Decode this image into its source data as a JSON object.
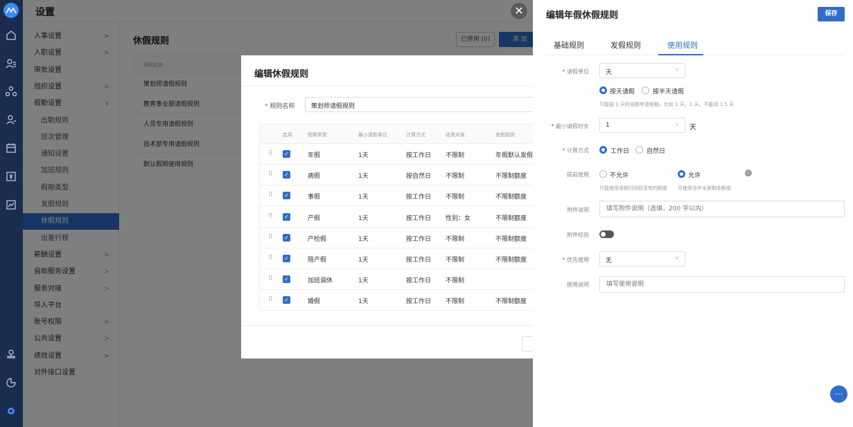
{
  "app": {
    "title": "设置"
  },
  "rail_icons": [
    "logo-icon",
    "home-icon",
    "user-list-icon",
    "org-icon",
    "person-icon",
    "calendar-icon",
    "wallet-icon",
    "chart-icon",
    "stamp-icon",
    "pie-icon",
    "settings-icon"
  ],
  "sidebar": {
    "items": [
      {
        "label": "人事设置",
        "chev": ">"
      },
      {
        "label": "入职设置",
        "chev": ">"
      },
      {
        "label": "审批设置",
        "chev": ""
      },
      {
        "label": "组织设置",
        "chev": ">"
      },
      {
        "label": "假勤设置",
        "chev": "∨"
      },
      {
        "label": "出勤规则",
        "chev": ""
      },
      {
        "label": "班次管理",
        "chev": ""
      },
      {
        "label": "通知设置",
        "chev": ""
      },
      {
        "label": "加班规则",
        "chev": ""
      },
      {
        "label": "假期类型",
        "chev": ""
      },
      {
        "label": "发假规则",
        "chev": ""
      },
      {
        "label": "休假规则",
        "chev": ""
      },
      {
        "label": "出差行程",
        "chev": ""
      },
      {
        "label": "薪酬设置",
        "chev": ">"
      },
      {
        "label": "自助服务设置",
        "chev": ">"
      },
      {
        "label": "服务对接",
        "chev": ">"
      },
      {
        "label": "导入平台",
        "chev": ""
      },
      {
        "label": "账号权限",
        "chev": ">"
      },
      {
        "label": "公共设置",
        "chev": ">"
      },
      {
        "label": "绩效设置",
        "chev": ">"
      },
      {
        "label": "对外接口设置",
        "chev": ""
      }
    ]
  },
  "page": {
    "title": "休假规则",
    "disabled_btn": "已停用 (0)",
    "add_btn": "添 加",
    "list_header": "规则名称",
    "list": [
      "策划师请假规则",
      "教育事业部请假规则",
      "人员专用请假规则",
      "技术部专用请假规则",
      "默认假期使用规则"
    ]
  },
  "modal": {
    "title": "编辑休假规则",
    "name_label": "规则名称",
    "name_value": "策划师请假规则",
    "headers": [
      "启用",
      "假期类型",
      "最小请假单位",
      "计算方式",
      "适用对象",
      "发假规则"
    ],
    "rows": [
      {
        "type": "年假",
        "unit": "1天",
        "calc": "按工作日",
        "target": "不限制",
        "rule": "年假默认发假规"
      },
      {
        "type": "病假",
        "unit": "1天",
        "calc": "按自然日",
        "target": "不限制",
        "rule": "不限制额度"
      },
      {
        "type": "事假",
        "unit": "1天",
        "calc": "按工作日",
        "target": "不限制",
        "rule": "不限制额度"
      },
      {
        "type": "产假",
        "unit": "1天",
        "calc": "按工作日",
        "target": "性别：女",
        "rule": "不限制额度"
      },
      {
        "type": "产检假",
        "unit": "1天",
        "calc": "按工作日",
        "target": "不限制",
        "rule": "不限制额度"
      },
      {
        "type": "陪产假",
        "unit": "1天",
        "calc": "按工作日",
        "target": "不限制",
        "rule": "不限制额度"
      },
      {
        "type": "加班调休",
        "unit": "1天",
        "calc": "按工作日",
        "target": "不限制",
        "rule": ""
      },
      {
        "type": "婚假",
        "unit": "1天",
        "calc": "按工作日",
        "target": "不限制",
        "rule": "不限制额度"
      }
    ]
  },
  "drawer": {
    "title": "编辑年假休假规则",
    "save": "保存",
    "tabs": [
      "基础规则",
      "发假规则",
      "使用规则"
    ],
    "active_tab": 2,
    "unit_label": "请假单位",
    "unit_value": "天",
    "unit_opt1": "按天请假",
    "unit_opt2": "按半天请假",
    "unit_hint": "只能按 1 天的倍数申请假期，比如 1 天、2 天，不能请 1.5 天",
    "min_label": "最小请假时长",
    "min_value": "1",
    "min_suffix": "天",
    "calc_label": "计算方式",
    "calc_opt1": "工作日",
    "calc_opt2": "自然日",
    "advance_label": "提前使用",
    "advance_opt1": "不允许",
    "advance_opt2": "允许",
    "advance_hint1": "只能使用请假时间段享有的额度",
    "advance_hint2": "可使用当年全部剩余额度",
    "attach_label": "附件说明",
    "attach_placeholder": "填写附件说明（选填，200 字以内）",
    "attach_check_label": "附件校验",
    "priority_label": "优先使用",
    "priority_value": "无",
    "usage_label": "使用说明",
    "usage_placeholder": "填写使用说明"
  },
  "colors": {
    "accent": "#2f6dc8",
    "rail": "#1a2d4f"
  }
}
